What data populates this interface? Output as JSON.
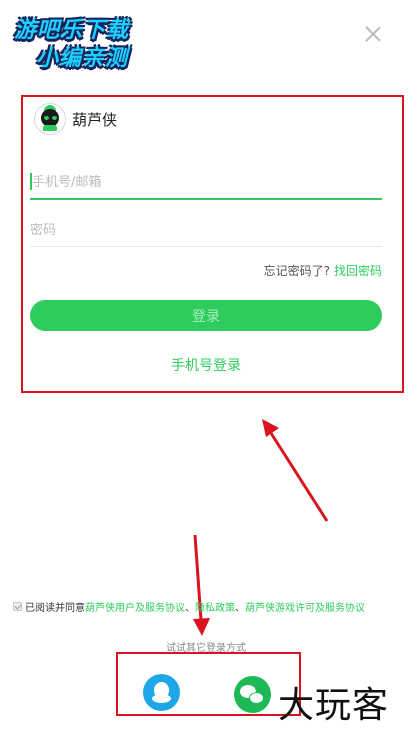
{
  "watermark_top": {
    "line1": "游吧乐下载",
    "line2": "小编亲测"
  },
  "app": {
    "name": "葫芦侠"
  },
  "form": {
    "phone_placeholder": "手机号/邮箱",
    "password_placeholder": "密码",
    "forgot_text": "忘记密码了?",
    "recover_link": "找回密码",
    "login_button": "登录",
    "phone_login_link": "手机号登录"
  },
  "agreement": {
    "prefix": "已阅读并同意",
    "link1": "葫芦侠用户及服务协议",
    "sep1": "、",
    "link2": "隐私政策",
    "sep2": "、",
    "link3": "葫芦侠游戏许可及服务协议"
  },
  "other_login": {
    "label": "试试其它登录方式",
    "options": [
      "qq-icon",
      "wechat-icon"
    ]
  },
  "watermark_bottom": "大玩客",
  "colors": {
    "accent": "#2ecc5d",
    "annotation_red": "#d9141f",
    "qq_blue": "#1ea7e8"
  }
}
